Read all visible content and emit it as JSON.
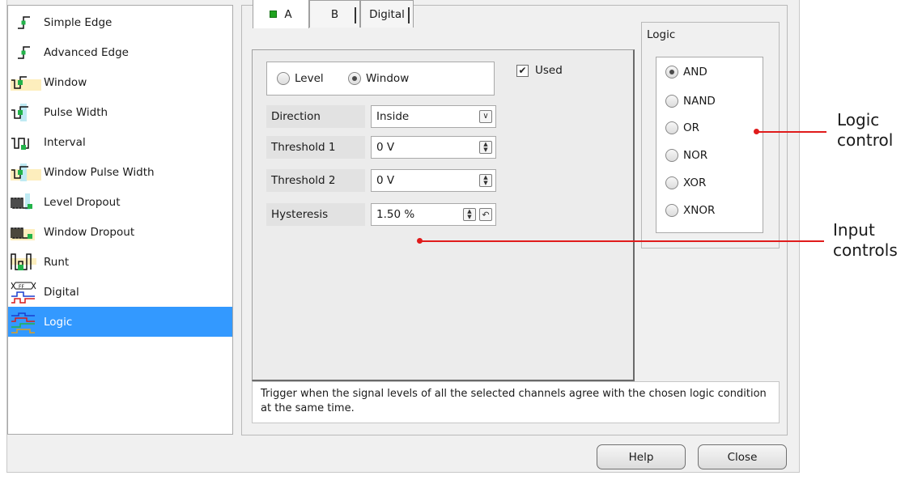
{
  "trigger_list": [
    {
      "label": "Simple Edge",
      "icon": "simple-edge-icon"
    },
    {
      "label": "Advanced Edge",
      "icon": "advanced-edge-icon"
    },
    {
      "label": "Window",
      "icon": "window-icon"
    },
    {
      "label": "Pulse Width",
      "icon": "pulse-width-icon"
    },
    {
      "label": "Interval",
      "icon": "interval-icon"
    },
    {
      "label": "Window Pulse Width",
      "icon": "window-pulse-width-icon"
    },
    {
      "label": "Level Dropout",
      "icon": "level-dropout-icon"
    },
    {
      "label": "Window Dropout",
      "icon": "window-dropout-icon"
    },
    {
      "label": "Runt",
      "icon": "runt-icon"
    },
    {
      "label": "Digital",
      "icon": "digital-icon"
    },
    {
      "label": "Logic",
      "icon": "logic-icon",
      "selected": true
    }
  ],
  "tabs": [
    {
      "label": "A",
      "active": true,
      "checked": true
    },
    {
      "label": "B",
      "active": false
    },
    {
      "label": "Digital",
      "active": false
    }
  ],
  "mode": {
    "options": [
      "Level",
      "Window"
    ],
    "selected": "Window"
  },
  "used": {
    "label": "Used",
    "checked": true
  },
  "fields": {
    "direction": {
      "label": "Direction",
      "value": "Inside"
    },
    "threshold1": {
      "label": "Threshold 1",
      "value": "0 V"
    },
    "threshold2": {
      "label": "Threshold 2",
      "value": "0 V"
    },
    "hysteresis": {
      "label": "Hysteresis",
      "value": "1.50 %"
    }
  },
  "logic": {
    "title": "Logic",
    "options": [
      "AND",
      "NAND",
      "OR",
      "NOR",
      "XOR",
      "XNOR"
    ],
    "selected": "AND"
  },
  "description": "Trigger when the signal levels of all the selected channels agree with the chosen logic condition at the same time.",
  "buttons": {
    "help": "Help",
    "close": "Close"
  },
  "callouts": {
    "logic_control": [
      "Logic",
      "control"
    ],
    "input_controls": [
      "Input",
      "controls"
    ]
  },
  "colors": {
    "selection": "#3399ff",
    "callout": "#e01b1b",
    "signal_green": "#22b34a",
    "window_fill": "#fdeebd",
    "pulse_fill": "#bfeaf3"
  }
}
